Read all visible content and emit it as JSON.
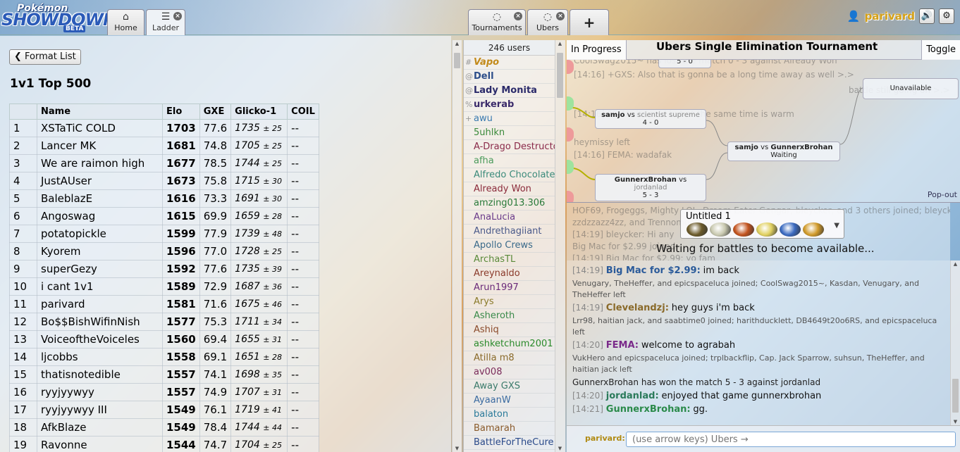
{
  "header": {
    "logo_line1": "Pokémon",
    "logo_line2": "SHOWDOWN!",
    "logo_badge": "BETA",
    "tabs_left": [
      {
        "label": "Home",
        "icon": "home-icon"
      },
      {
        "label": "Ladder",
        "icon": "ladder-icon"
      }
    ],
    "tabs_right": [
      {
        "label": "Tournaments",
        "icon": "chat-bubble-icon"
      },
      {
        "label": "Ubers",
        "icon": "chat-bubble-icon"
      }
    ],
    "add_tab_label": "+",
    "username": "parivard"
  },
  "ladder": {
    "format_button": "Format List",
    "title": "1v1 Top 500",
    "columns": [
      "",
      "Name",
      "Elo",
      "GXE",
      "Glicko-1",
      "COIL"
    ],
    "rows": [
      {
        "rank": "1",
        "name": "XSTaTiC COLD",
        "elo": "1703",
        "gxe": "77.6",
        "glicko": "1735",
        "dev": "± 25",
        "coil": "--"
      },
      {
        "rank": "2",
        "name": "Lancer MK",
        "elo": "1681",
        "gxe": "74.8",
        "glicko": "1705",
        "dev": "± 25",
        "coil": "--"
      },
      {
        "rank": "3",
        "name": "We are raimon high",
        "elo": "1677",
        "gxe": "78.5",
        "glicko": "1744",
        "dev": "± 25",
        "coil": "--"
      },
      {
        "rank": "4",
        "name": "JustAUser",
        "elo": "1673",
        "gxe": "75.8",
        "glicko": "1715",
        "dev": "± 30",
        "coil": "--"
      },
      {
        "rank": "5",
        "name": "BaleblazE",
        "elo": "1616",
        "gxe": "73.3",
        "glicko": "1691",
        "dev": "± 30",
        "coil": "--"
      },
      {
        "rank": "6",
        "name": "Angoswag",
        "elo": "1615",
        "gxe": "69.9",
        "glicko": "1659",
        "dev": "± 28",
        "coil": "--"
      },
      {
        "rank": "7",
        "name": "potatopickle",
        "elo": "1599",
        "gxe": "77.9",
        "glicko": "1739",
        "dev": "± 48",
        "coil": "--"
      },
      {
        "rank": "8",
        "name": "Kyorem",
        "elo": "1596",
        "gxe": "77.0",
        "glicko": "1728",
        "dev": "± 25",
        "coil": "--"
      },
      {
        "rank": "9",
        "name": "superGezy",
        "elo": "1592",
        "gxe": "77.6",
        "glicko": "1735",
        "dev": "± 39",
        "coil": "--"
      },
      {
        "rank": "10",
        "name": "i cant 1v1",
        "elo": "1589",
        "gxe": "72.9",
        "glicko": "1687",
        "dev": "± 36",
        "coil": "--"
      },
      {
        "rank": "11",
        "name": "parivard",
        "elo": "1581",
        "gxe": "71.6",
        "glicko": "1675",
        "dev": "± 46",
        "coil": "--"
      },
      {
        "rank": "12",
        "name": "Bo$$BishWifinNish",
        "elo": "1577",
        "gxe": "75.3",
        "glicko": "1711",
        "dev": "± 34",
        "coil": "--"
      },
      {
        "rank": "13",
        "name": "VoiceoftheVoiceles",
        "elo": "1560",
        "gxe": "69.4",
        "glicko": "1655",
        "dev": "± 31",
        "coil": "--"
      },
      {
        "rank": "14",
        "name": "ljcobbs",
        "elo": "1558",
        "gxe": "69.1",
        "glicko": "1651",
        "dev": "± 28",
        "coil": "--"
      },
      {
        "rank": "15",
        "name": "thatisnotedible",
        "elo": "1557",
        "gxe": "74.1",
        "glicko": "1698",
        "dev": "± 35",
        "coil": "--"
      },
      {
        "rank": "16",
        "name": "ryyjyywyy",
        "elo": "1557",
        "gxe": "74.9",
        "glicko": "1707",
        "dev": "± 31",
        "coil": "--"
      },
      {
        "rank": "17",
        "name": "ryyjyywyy III",
        "elo": "1549",
        "gxe": "76.1",
        "glicko": "1719",
        "dev": "± 41",
        "coil": "--"
      },
      {
        "rank": "18",
        "name": "AfkBlaze",
        "elo": "1549",
        "gxe": "78.4",
        "glicko": "1744",
        "dev": "± 44",
        "coil": "--"
      },
      {
        "rank": "19",
        "name": "Ravonne",
        "elo": "1544",
        "gxe": "74.7",
        "glicko": "1704",
        "dev": "± 25",
        "coil": "--"
      }
    ]
  },
  "userlist": {
    "count": "246 users",
    "users": [
      {
        "group": "#",
        "name": "Vapo",
        "color": "#c28a1a",
        "style": "bold-italic"
      },
      {
        "group": "@",
        "name": "Dell",
        "color": "#2d4e8a",
        "style": "bold"
      },
      {
        "group": "@",
        "name": "Lady Monita",
        "color": "#2a2a6a",
        "style": "bold"
      },
      {
        "group": "%",
        "name": "urkerab",
        "color": "#3a2a6a",
        "style": "bold"
      },
      {
        "group": "+",
        "name": "awu",
        "color": "#3a7ab0",
        "style": "normal"
      },
      {
        "group": "",
        "name": "5uhlkn",
        "color": "#3a8a3a",
        "style": "normal"
      },
      {
        "group": "",
        "name": "A-Drago Destructor",
        "color": "#8a2a4a",
        "style": "normal"
      },
      {
        "group": "",
        "name": "afha",
        "color": "#4a9a5a",
        "style": "normal"
      },
      {
        "group": "",
        "name": "Alfredo Chocolate",
        "color": "#3a8a7a",
        "style": "normal"
      },
      {
        "group": "",
        "name": "Already Won",
        "color": "#8a2a3a",
        "style": "normal"
      },
      {
        "group": "",
        "name": "amzing013.306",
        "color": "#2a7a3a",
        "style": "normal"
      },
      {
        "group": "",
        "name": "AnaLucia",
        "color": "#6a3a8a",
        "style": "normal"
      },
      {
        "group": "",
        "name": "Andrethagiiant",
        "color": "#4a5a8a",
        "style": "normal"
      },
      {
        "group": "",
        "name": "Apollo Crews",
        "color": "#3a6a8a",
        "style": "normal"
      },
      {
        "group": "",
        "name": "ArchasTL",
        "color": "#5a8a3a",
        "style": "normal"
      },
      {
        "group": "",
        "name": "Areynaldo",
        "color": "#8a3a2a",
        "style": "normal"
      },
      {
        "group": "",
        "name": "Arun1997",
        "color": "#6a2a7a",
        "style": "normal"
      },
      {
        "group": "",
        "name": "Arys",
        "color": "#8a7a2a",
        "style": "normal"
      },
      {
        "group": "",
        "name": "Asheroth",
        "color": "#3a8a4a",
        "style": "normal"
      },
      {
        "group": "",
        "name": "Ashiq",
        "color": "#8a4a2a",
        "style": "normal"
      },
      {
        "group": "",
        "name": "ashketchum2001",
        "color": "#2a8a2a",
        "style": "normal"
      },
      {
        "group": "",
        "name": "Atilla m8",
        "color": "#8a6a2a",
        "style": "normal"
      },
      {
        "group": "",
        "name": "av008",
        "color": "#7a2a5a",
        "style": "normal"
      },
      {
        "group": "",
        "name": "Away GXS",
        "color": "#3a7a6a",
        "style": "normal"
      },
      {
        "group": "",
        "name": "AyaanW",
        "color": "#3a6aa0",
        "style": "normal"
      },
      {
        "group": "",
        "name": "balaton",
        "color": "#2a7a9a",
        "style": "normal"
      },
      {
        "group": "",
        "name": "Bamarah",
        "color": "#8a5a2a",
        "style": "normal"
      },
      {
        "group": "",
        "name": "BattleForTheCure",
        "color": "#2a4a8a",
        "style": "normal"
      }
    ]
  },
  "tournament": {
    "status": "In Progress",
    "title": "Ubers Single Elimination Tournament",
    "toggle": "Toggle",
    "popout": "Pop-out",
    "matches": [
      {
        "p1": "samjo",
        "vs": "vs",
        "p2": "scientist supreme",
        "score": "4 - 0"
      },
      {
        "p1": "GunnerxBrohan",
        "vs": "vs",
        "p2": "jordanlad",
        "score": "5 - 3"
      },
      {
        "p1": "samjo",
        "vs": "vs",
        "p2": "GunnerxBrohan",
        "score": "Waiting"
      },
      {
        "p1": "Unavailable",
        "vs": "",
        "p2": "",
        "score": ""
      },
      {
        "p1": "5 - 0",
        "vs": "",
        "p2": "",
        "score": ""
      }
    ],
    "bg_lines": [
      "CoolSwag2015~ has lost the match 0 - 3 against Already Won",
      "[14:16] +GXS:  Also that is gonna be a long time away as well >.>",
      "battle still going on >.>",
      "[14:16] FEMA:  its cold but at the same time is warm",
      "heymissy left",
      "[14:16] FEMA:  wadafak",
      "HOF69, Frogeggs, Mighty LOL, Dream Eater Gengar, bleycker, and 3 others joined; bleycker,",
      "zzdzzazz4zz, and Trennomo",
      "[14:19] bleycker:  Hi any",
      "Big Mac for $2.99 joined",
      "[14:19] Big Mac for $2.99:  yo fam"
    ]
  },
  "team": {
    "name": "Untitled 1",
    "icons": [
      "giratina-icon",
      "arceus-icon",
      "groudon-icon",
      "zekrom-icon",
      "kyogre-icon",
      "ho-oh-icon"
    ],
    "waiting_text": "Waiting for battles to become available..."
  },
  "chat": {
    "lines": [
      {
        "type": "msg",
        "ts": "[14:19]",
        "author": "Big Mac for $2.99:",
        "color": "#2a5a9a",
        "text": "im back"
      },
      {
        "type": "notice",
        "text": "Venugary, TheHeffer, and epicspaceluca joined; CoolSwag2015~, Kasdan, Venugary, and TheHeffer left"
      },
      {
        "type": "msg",
        "ts": "[14:19]",
        "author": "Clevelandzj:",
        "color": "#8a6a2a",
        "text": "hey guys i'm back"
      },
      {
        "type": "notice",
        "text": "Lrr98, haitian jack, and saabtime0 joined; harithducklett, DB4649t20o6RS, and epicspaceluca left"
      },
      {
        "type": "msg",
        "ts": "[14:20]",
        "author": "FEMA:",
        "color": "#7a2a8a",
        "text": "welcome to agrabah"
      },
      {
        "type": "notice",
        "text": "VukHero and epicspaceluca joined; trplbackflip, Cap. Jack Sparrow, suhsun, TheHeffer, and haitian jack left"
      },
      {
        "type": "plain",
        "text": "GunnerxBrohan has won the match 5 - 3 against jordanlad"
      },
      {
        "type": "msg",
        "ts": "[14:20]",
        "author": "jordanlad:",
        "color": "#2a7a5a",
        "text": "enjoyed that game gunnerxbrohan"
      },
      {
        "type": "msg",
        "ts": "[14:21]",
        "author": "GunnerxBrohan:",
        "color": "#2a8a4a",
        "text": "gg."
      }
    ],
    "name_label": "parivard:",
    "input_placeholder": "(use arrow keys) Ubers →"
  }
}
